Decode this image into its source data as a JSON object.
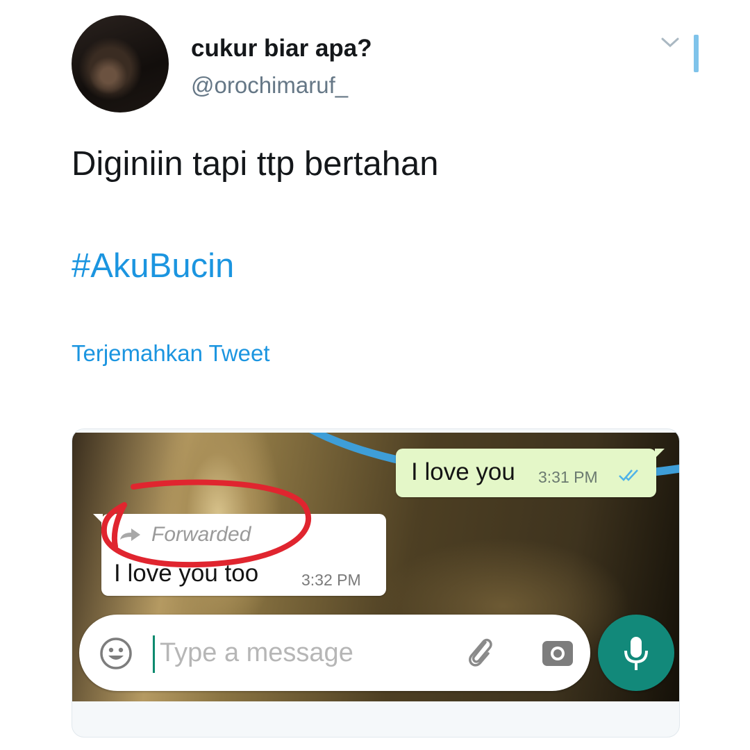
{
  "tweet": {
    "display_name": "cukur biar apa?",
    "handle": "@orochimaruf_",
    "text": "Diginiin tapi ttp bertahan",
    "hashtag": "#AkuBucin",
    "translate_label": "Terjemahkan Tweet",
    "link_color": "#1b95e0"
  },
  "chat": {
    "outgoing": {
      "text": "I love you",
      "time": "3:31 PM",
      "status_icon": "double-check-icon",
      "bubble_color": "#e4f7c8"
    },
    "incoming": {
      "forwarded_label": "Forwarded",
      "forwarded_icon": "forward-arrow-icon",
      "text": "I love you too",
      "time": "3:32 PM",
      "bubble_color": "#ffffff"
    },
    "annotation_color": "#e0252f",
    "composer": {
      "placeholder": "Type a message",
      "emoji_icon": "emoji-icon",
      "attach_icon": "paperclip-icon",
      "camera_icon": "camera-icon",
      "mic_icon": "microphone-icon",
      "mic_button_color": "#12897a"
    }
  }
}
